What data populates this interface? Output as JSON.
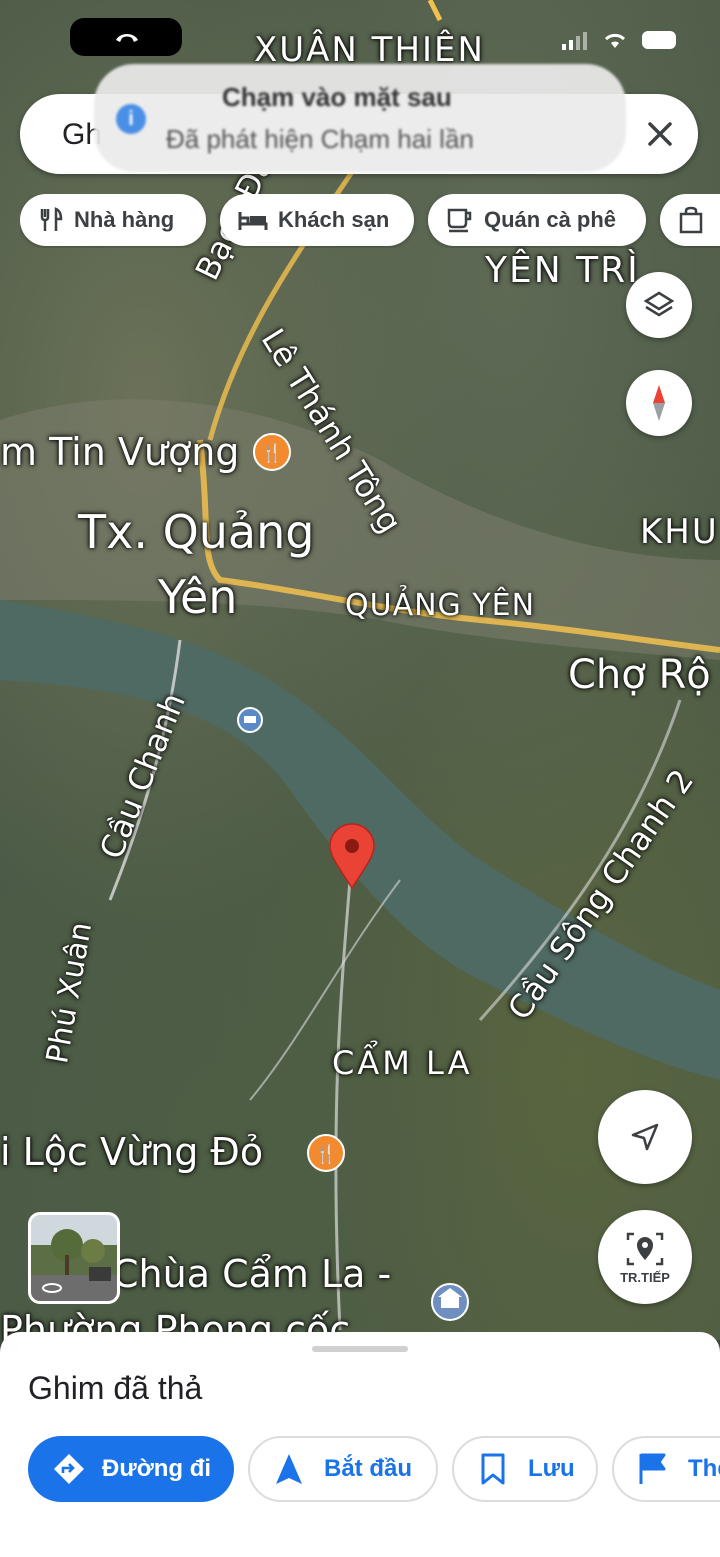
{
  "status_bar": {
    "area_label": "XUÂN THIÊN"
  },
  "toast": {
    "title": "Chạm vào mặt sau",
    "subtitle": "Đã phát hiện Chạm hai lần"
  },
  "search": {
    "value": "Gh"
  },
  "chips": [
    {
      "label": "Nhà hàng",
      "icon": "fork-knife-icon"
    },
    {
      "label": "Khách sạn",
      "icon": "bed-icon"
    },
    {
      "label": "Quán cà phê",
      "icon": "coffee-icon"
    },
    {
      "label": "",
      "icon": "shopping-bag-icon"
    }
  ],
  "map_labels": {
    "yen_tri": "YÊN TRÌ",
    "bach_dang": "Bạch Đằ",
    "le_thanh_tong": "Lê Thánh Tông",
    "tin_vuong": "m Tin Vượng",
    "tx_quang_yen_1": "Tx. Quảng",
    "tx_quang_yen_2": "Yên",
    "quang_yen": "QUẢNG YÊN",
    "khu": "KHU",
    "cho_ro": "Chợ Rộ",
    "cau_chanh": "Cầu Chanh",
    "cau_song_chanh": "Cầu Sông Chanh 2",
    "phu_xuan": "Phú Xuân",
    "cam_la": "CẨM LA",
    "loc_vung_do": "i Lộc Vừng Đỏ",
    "chua_cam_la": "Chùa Cẩm La -",
    "phuong_phong_coc": "Phường Phong cốc"
  },
  "live_view_label": "TR.TIẾP",
  "bottom_sheet": {
    "title": "Ghim đã thả",
    "actions": [
      {
        "label": "Đường đi",
        "icon": "directions-icon",
        "primary": true
      },
      {
        "label": "Bắt đầu",
        "icon": "navigation-arrow-icon",
        "primary": false
      },
      {
        "label": "Lưu",
        "icon": "bookmark-icon",
        "primary": false
      },
      {
        "label": "Thê",
        "icon": "flag-icon",
        "primary": false
      }
    ]
  },
  "colors": {
    "primary": "#1a73e8",
    "pin": "#ea4335",
    "poi": "#f28b30",
    "road": "#f2c14e"
  }
}
